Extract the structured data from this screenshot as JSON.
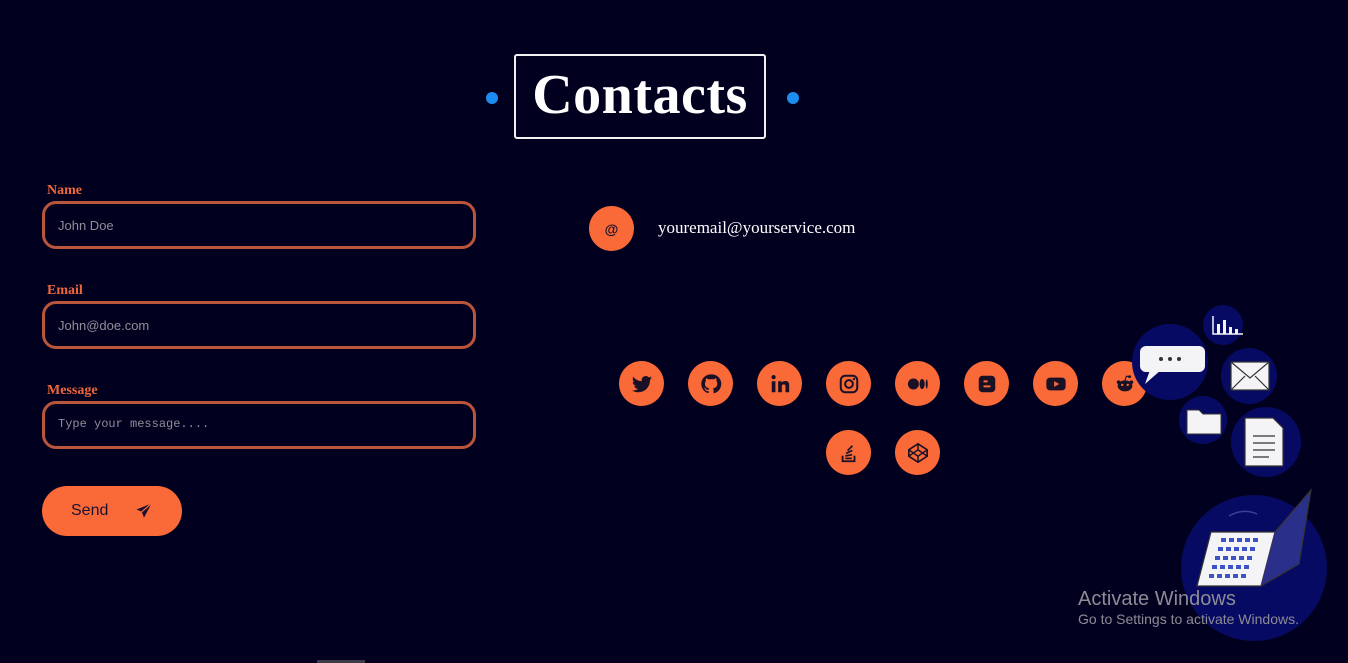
{
  "header": {
    "title": "Contacts"
  },
  "form": {
    "name": {
      "label": "Name",
      "placeholder": "John Doe"
    },
    "email": {
      "label": "Email",
      "placeholder": "John@doe.com"
    },
    "message": {
      "label": "Message",
      "placeholder": "Type your message...."
    },
    "send_label": "Send"
  },
  "contact": {
    "email_icon_glyph": "@",
    "email": "youremail@yourservice.com"
  },
  "social_icons": [
    "twitter-icon",
    "github-icon",
    "linkedin-icon",
    "instagram-icon",
    "medium-icon",
    "blogger-icon",
    "youtube-icon",
    "reddit-icon",
    "stackoverflow-icon",
    "codepen-icon"
  ],
  "colors": {
    "background": "#02001f",
    "accent": "#f96a38",
    "label": "#f0673a",
    "dot": "#1d8cf0",
    "field_border": "#b9553a"
  },
  "watermark": {
    "line1": "Activate Windows",
    "line2": "Go to Settings to activate Windows."
  }
}
